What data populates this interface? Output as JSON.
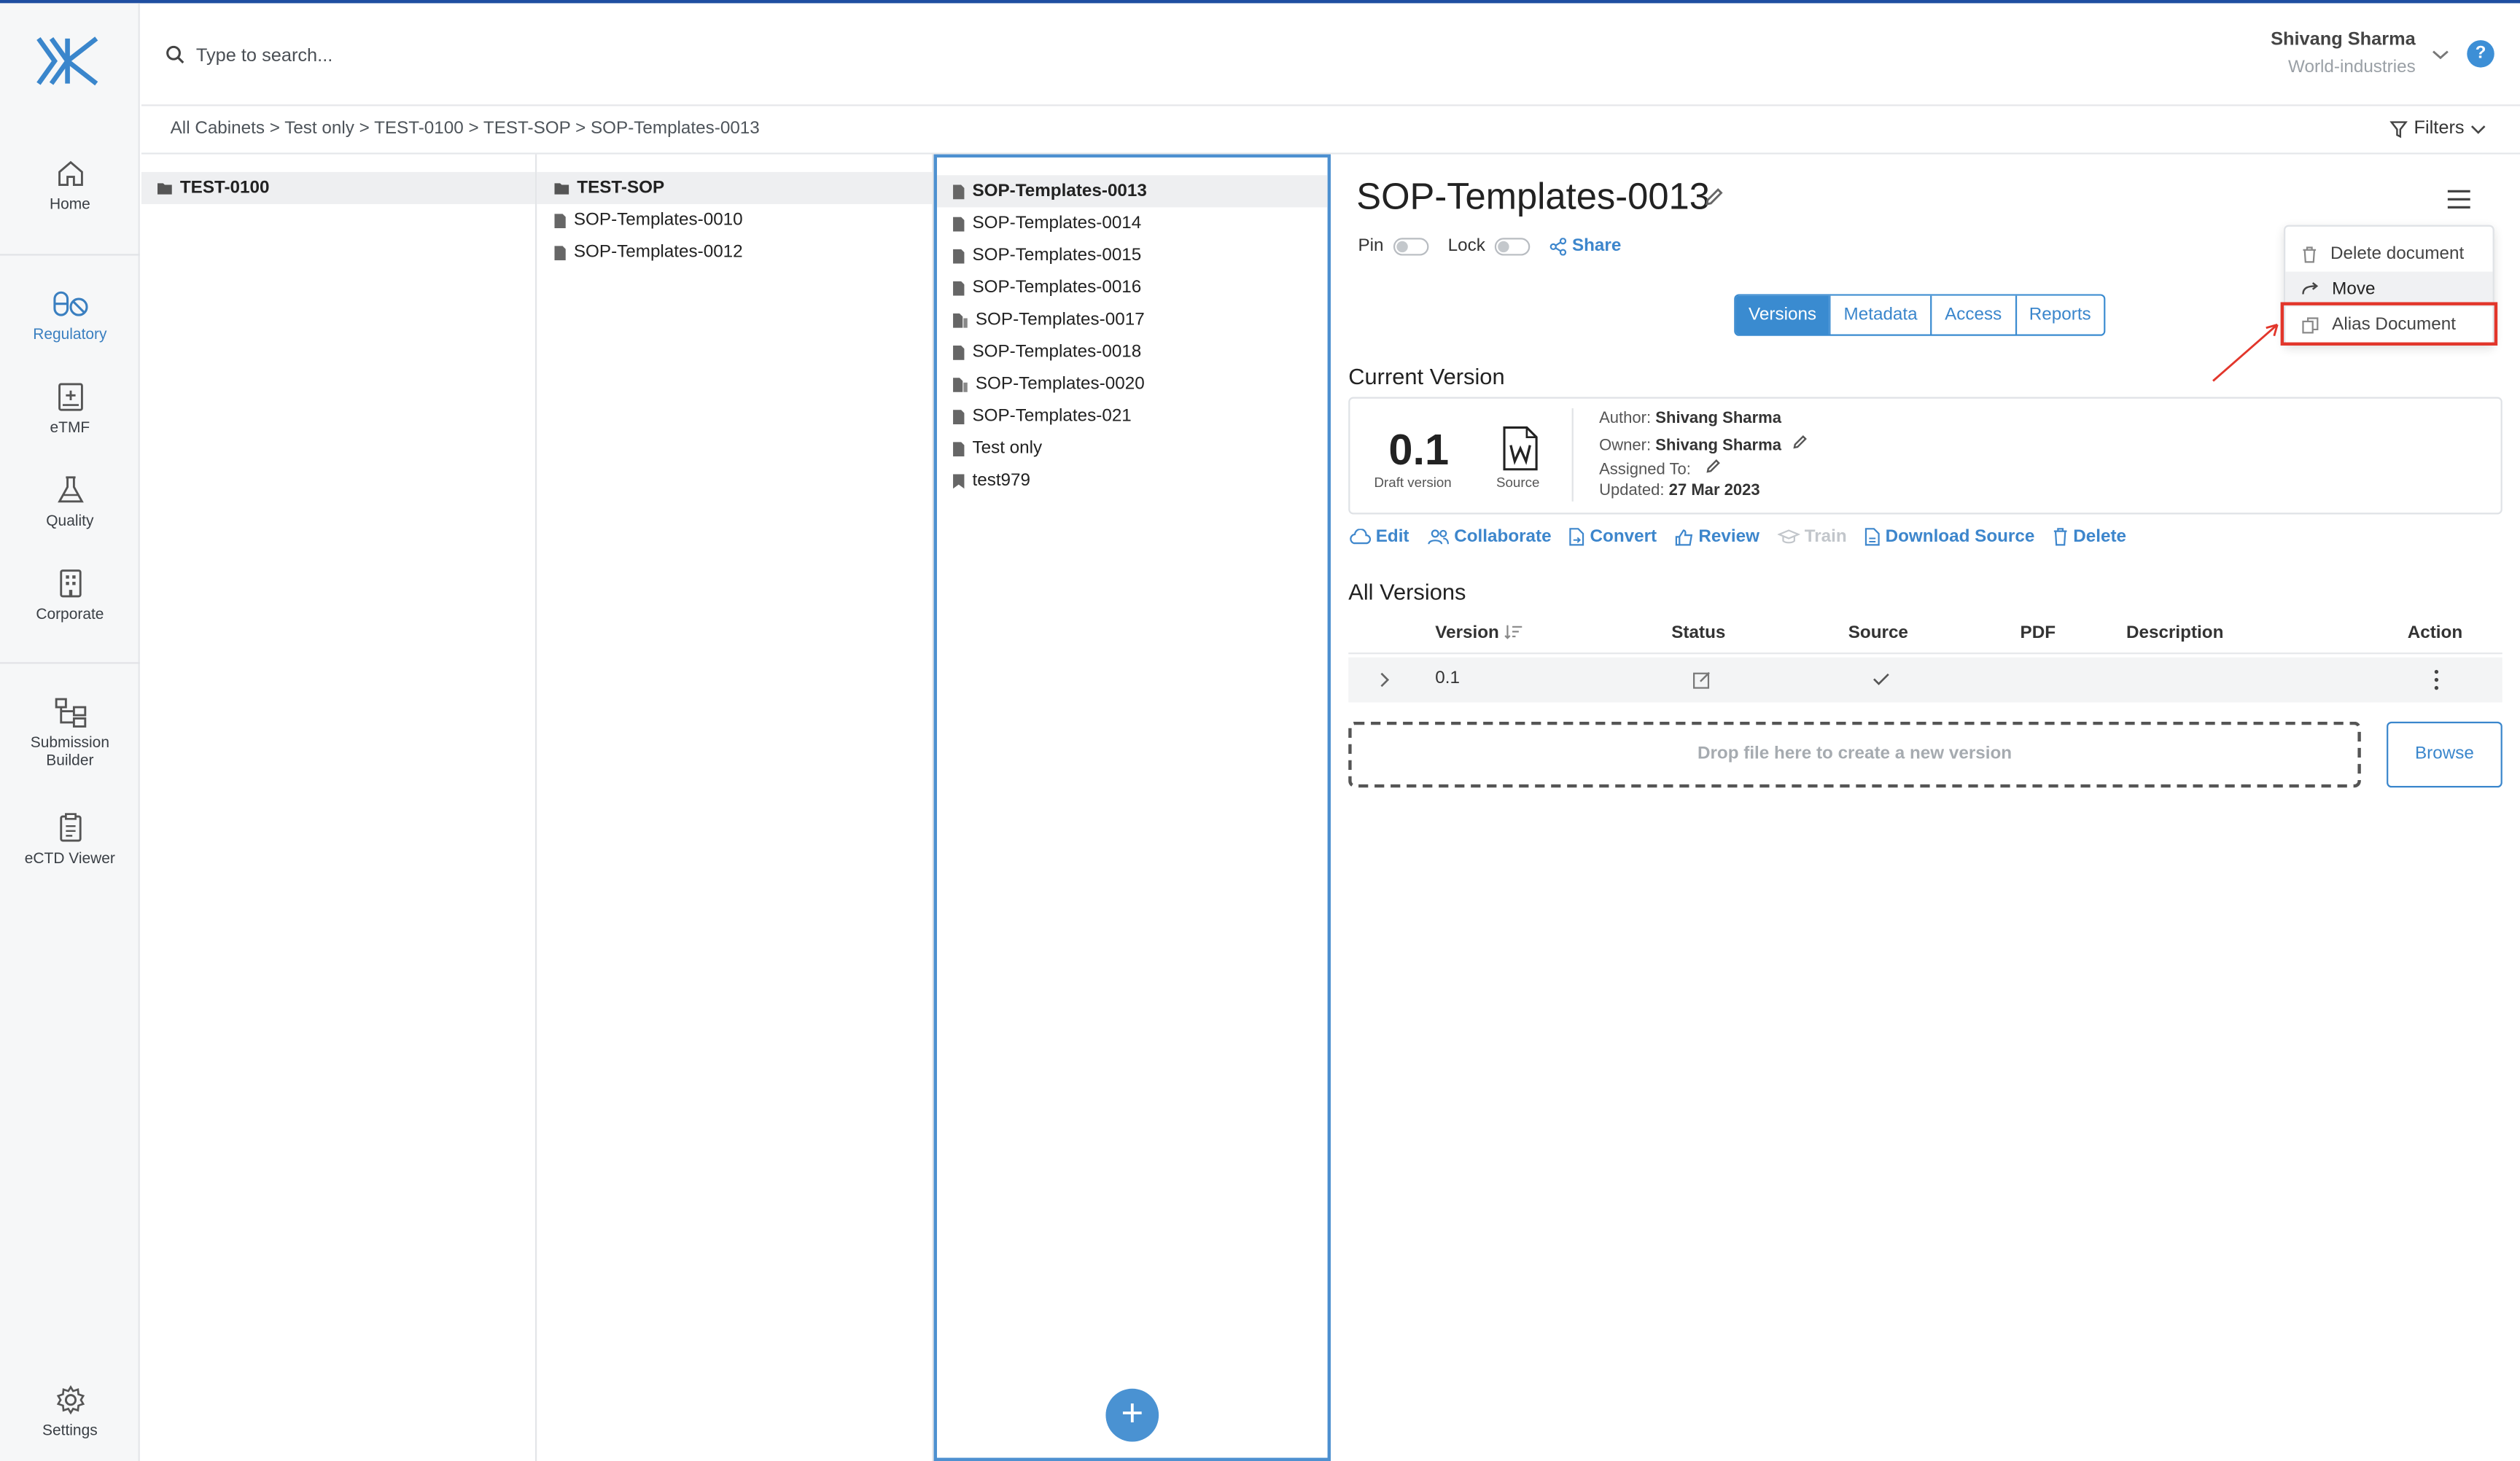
{
  "header": {
    "search_placeholder": "Type to search...",
    "user_name": "Shivang Sharma",
    "user_org": "World-industries",
    "help": "?"
  },
  "sidebar": {
    "items": [
      {
        "label": "Home"
      },
      {
        "label": "Regulatory"
      },
      {
        "label": "eTMF"
      },
      {
        "label": "Quality"
      },
      {
        "label": "Corporate"
      },
      {
        "label": "Submission Builder",
        "line1": "Submission",
        "line2": "Builder"
      },
      {
        "label": "eCTD Viewer"
      },
      {
        "label": "Settings"
      }
    ]
  },
  "breadcrumb": {
    "text": "All Cabinets > Test only > TEST-0100 > TEST-SOP > SOP-Templates-0013",
    "filters_label": "Filters"
  },
  "columns": {
    "col1": [
      "TEST-0100"
    ],
    "col2": [
      "TEST-SOP",
      "SOP-Templates-0010",
      "SOP-Templates-0012"
    ],
    "col3": [
      "SOP-Templates-0013",
      "SOP-Templates-0014",
      "SOP-Templates-0015",
      "SOP-Templates-0016",
      "SOP-Templates-0017",
      "SOP-Templates-0018",
      "SOP-Templates-0020",
      "SOP-Templates-021",
      "Test only",
      "test979"
    ],
    "fab": "+"
  },
  "detail": {
    "title": "SOP-Templates-0013",
    "pin_label": "Pin",
    "lock_label": "Lock",
    "share_label": "Share",
    "tabs": [
      "Versions",
      "Metadata",
      "Access",
      "Reports"
    ],
    "menu": [
      "Delete document",
      "Move",
      "Alias Document"
    ],
    "current_version_title": "Current Version",
    "version_number": "0.1",
    "version_status": "Draft version",
    "source_label": "Source",
    "author_label": "Author:",
    "author": "Shivang Sharma",
    "owner_label": "Owner:",
    "owner": "Shivang Sharma",
    "assigned_label": "Assigned To:",
    "updated_label": "Updated:",
    "updated": "27 Mar 2023",
    "actions": [
      "Edit",
      "Collaborate",
      "Convert",
      "Review",
      "Train",
      "Download Source",
      "Delete"
    ],
    "all_versions_title": "All Versions",
    "table_headers": [
      "Version",
      "Status",
      "Source",
      "PDF",
      "Description",
      "Action"
    ],
    "table_rows": [
      {
        "version": "0.1"
      }
    ],
    "dropzone": "Drop file here to create a new version",
    "browse": "Browse"
  }
}
